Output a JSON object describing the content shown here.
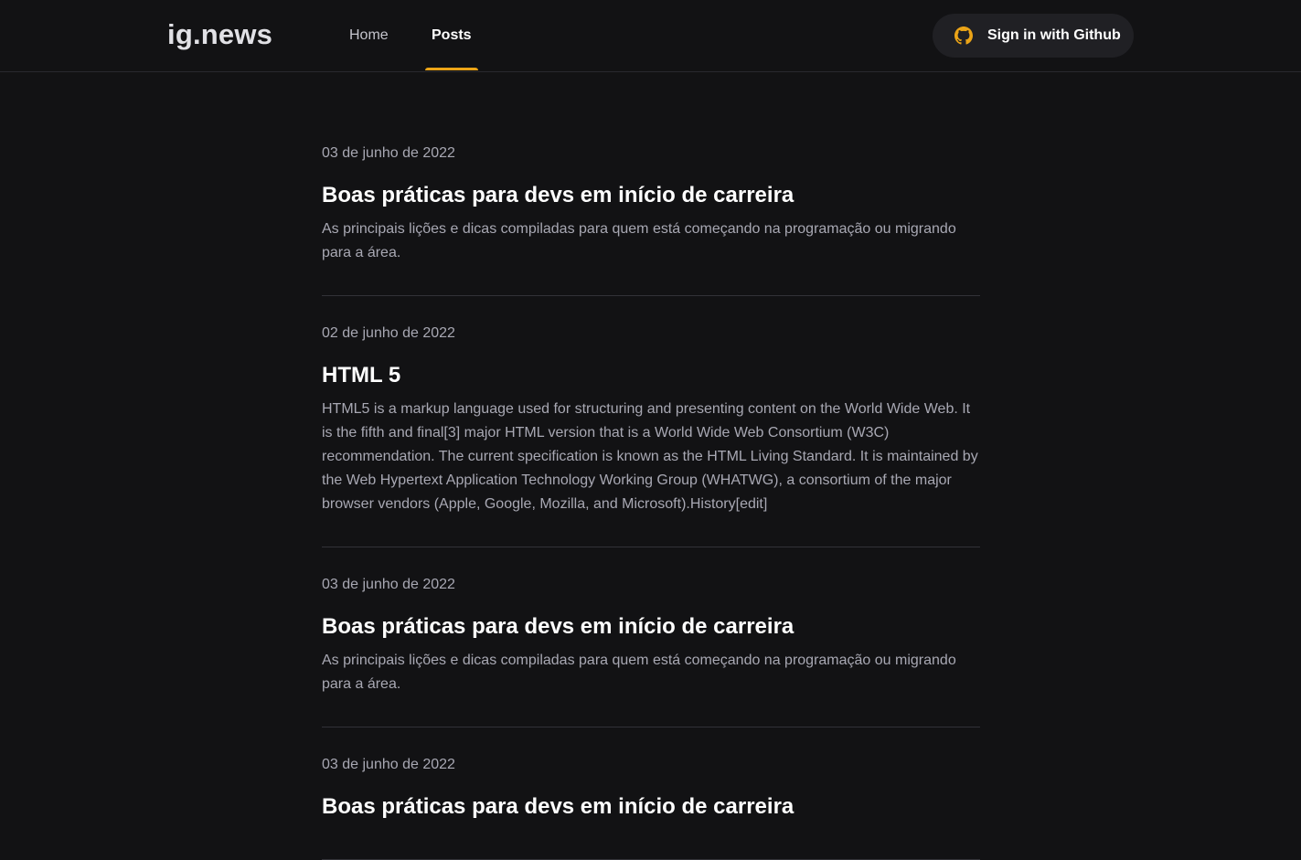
{
  "header": {
    "logo": "ig.news",
    "nav": {
      "home": "Home",
      "posts": "Posts"
    },
    "signin_label": "Sign in with Github"
  },
  "icons": {
    "signin": "github-icon"
  },
  "colors": {
    "background": "#121214",
    "accent": "#eba417",
    "github_icon": "#eba417"
  },
  "posts": [
    {
      "date": "03 de junho de 2022",
      "title": "Boas práticas para devs em início de carreira",
      "excerpt": "As principais lições e dicas compiladas para quem está começando na programação ou migrando para a área."
    },
    {
      "date": "02 de junho de 2022",
      "title": "HTML 5",
      "excerpt": "HTML5 is a markup language used for structuring and presenting content on the World Wide Web. It is the fifth and final[3] major HTML version that is a World Wide Web Consortium (W3C) recommendation. The current specification is known as the HTML Living Standard. It is maintained by the Web Hypertext Application Technology Working Group (WHATWG), a consortium of the major browser vendors (Apple, Google, Mozilla, and Microsoft).History[edit]"
    },
    {
      "date": "03 de junho de 2022",
      "title": "Boas práticas para devs em início de carreira",
      "excerpt": "As principais lições e dicas compiladas para quem está começando na programação ou migrando para a área."
    },
    {
      "date": "03 de junho de 2022",
      "title": "Boas práticas para devs em início de carreira",
      "excerpt": ""
    }
  ]
}
